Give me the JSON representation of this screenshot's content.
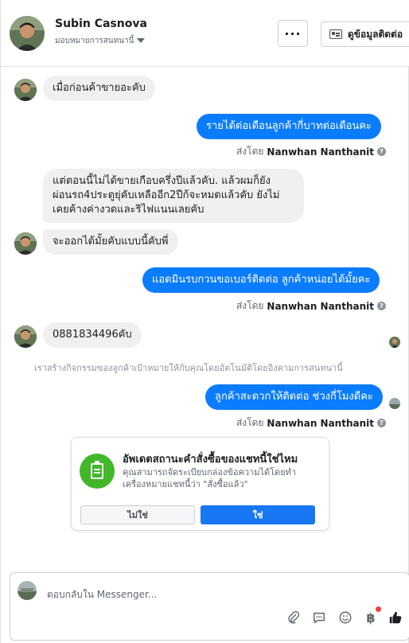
{
  "header": {
    "contact_name": "Subin Casnova",
    "assign_label": "มอบหมายการสนทนานี้",
    "more_label": "···",
    "contact_info_label": "ดูข้อมูลติดต่อ"
  },
  "messages": {
    "m1": "เมื่อก่อนค้าขายอะคับ",
    "m2": "รายได้ต่อเดือนลูกค้ากี่บาทต่อเดือนคะ",
    "m3": "แต่ตอนนี้ไม่ได้ขายเกือบครึ่งปีแล้วคับ. แล้วผมก็ยัง\nผ่อนรถ4ประตูยุ่คับเหลืออีก2ปีก้จะหมดแล้วคับ ยังไม่\nเคยค้างค่างวดและริไฟแนนเลยคับ",
    "m4": "จะออกได้มั้ยคับแบบนี้คับพี่",
    "m5": "แอดมินรบกวนขอเบอร์ติดต่อ ลูกค้าหน่อยได้มั้ยคะ",
    "m6": "0881834496คับ",
    "m7": "ลูกค้าสะดวกให้ติดต่อ ช่วงกี่โมงดีคะ"
  },
  "sent_by": {
    "prefix": "ส่งโดย",
    "sender": "Nanwhan Nanthanit",
    "info_icon": "?"
  },
  "system_note": "เราสร้างกิจกรรมของลูกค้าเป้าหมายให้กับคุณโดยอัตโนมัติโดยอิงตามการสนทนานี้",
  "order_card": {
    "title": "อัพเดตสถานะคำสั่งซื้อของแชทนี้ใช่ไหม",
    "description": "คุณสามารถจัดระเบียบกล่องข้อความได้โดยทำเครื่องหมายแชทนี้ว่า \"สั่งซื้อแล้ว\"",
    "no_label": "ไม่ใช่",
    "yes_label": "ใช่"
  },
  "composer": {
    "placeholder": "ตอบกลับใน Messenger...",
    "currency_symbol": "฿"
  },
  "colors": {
    "outgoing_bubble": "#0a7cff",
    "incoming_bubble": "#f1f0f0",
    "primary_button": "#1877f2",
    "order_icon_bg": "#42b72a",
    "like_icon": "#1c1e21",
    "notification_dot": "#fa3e3e"
  }
}
